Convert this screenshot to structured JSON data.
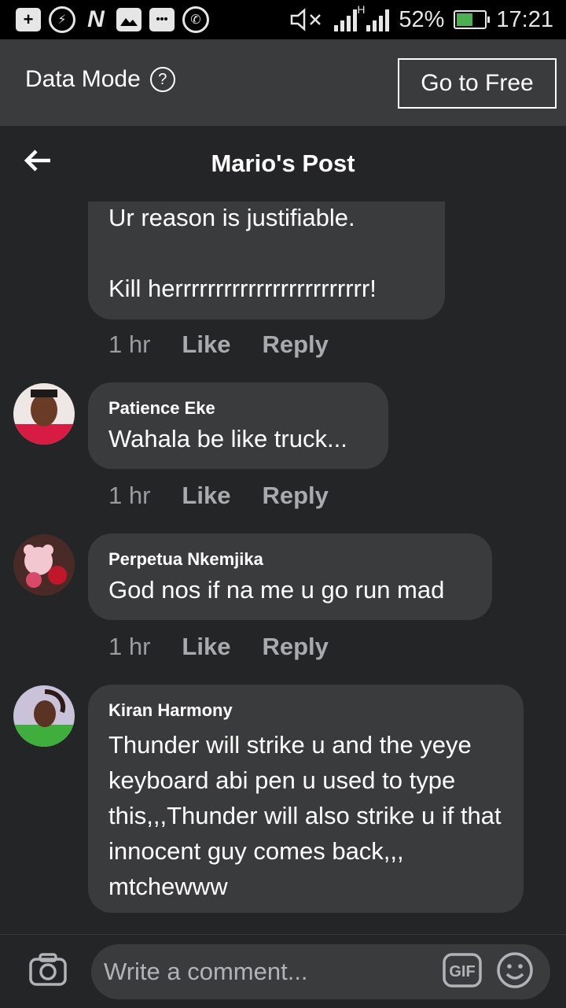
{
  "status_bar": {
    "notification_icons": [
      "plus-box-icon",
      "messenger-icon",
      "n-app-icon",
      "image-icon",
      "chat-icon",
      "whatsapp-icon"
    ],
    "network_type": "H",
    "battery_percent": "52%",
    "time": "17:21"
  },
  "data_mode": {
    "label": "Data Mode",
    "go_free_label": "Go to Free"
  },
  "header": {
    "title": "Mario's Post"
  },
  "comments": [
    {
      "author": "",
      "text": "Ur reason is justifiable.\n\nKill herrrrrrrrrrrrrrrrrrrrrrrr!",
      "time": "1 hr",
      "like_label": "Like",
      "reply_label": "Reply"
    },
    {
      "author": "Patience Eke",
      "text": "Wahala be like truck...",
      "time": "1 hr",
      "like_label": "Like",
      "reply_label": "Reply"
    },
    {
      "author": "Perpetua Nkemjika",
      "text": "God nos if na me u go run mad",
      "time": "1 hr",
      "like_label": "Like",
      "reply_label": "Reply"
    },
    {
      "author": "Kiran Harmony",
      "text": "Thunder will strike u and the yeye keyboard abi pen u used to type this,,,Thunder will also strike u if that innocent guy comes back,,, mtchewww",
      "time": "",
      "like_label": "",
      "reply_label": ""
    }
  ],
  "composer": {
    "placeholder": "Write a comment...",
    "gif_label": "GIF"
  },
  "colors": {
    "background": "#242526",
    "bubble": "#3a3b3c",
    "action_text": "#a8aaae",
    "avatar_patience": "#d81b43",
    "avatar_perpetua": "#f3c7cf",
    "avatar_kiran": "#3fae3c"
  }
}
